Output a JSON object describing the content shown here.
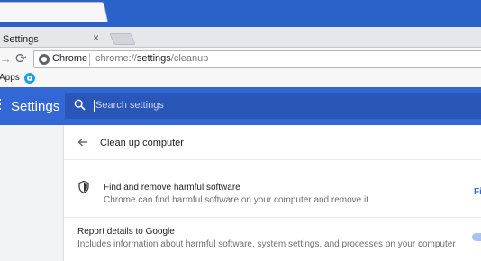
{
  "tab": {
    "title": "Settings",
    "close": "×"
  },
  "omnibox": {
    "site_name": "Chrome",
    "url_scheme": "chrome://",
    "url_host": "settings",
    "url_path": "/cleanup"
  },
  "bookmarks": {
    "apps_label": "Apps"
  },
  "header": {
    "title": "Settings",
    "search_placeholder": "Search settings"
  },
  "cleanup": {
    "page_title": "Clean up computer",
    "find_title": "Find and remove harmful software",
    "find_desc": "Chrome can find harmful software on your computer and remove it",
    "find_button": "Fi",
    "report_title": "Report details to Google",
    "report_desc": "Includes information about harmful software, system settings, and processes on your computer",
    "report_enabled": true
  },
  "colors": {
    "titlebar": "#2a62c9",
    "header": "#3367d6",
    "accent": "#3367d6"
  },
  "icons": {
    "forward": "forward-arrow-icon",
    "reload": "reload-icon",
    "site": "chrome-icon",
    "search": "search-icon",
    "menu": "menu-icon",
    "back": "back-arrow-icon",
    "shield": "shield-icon"
  }
}
